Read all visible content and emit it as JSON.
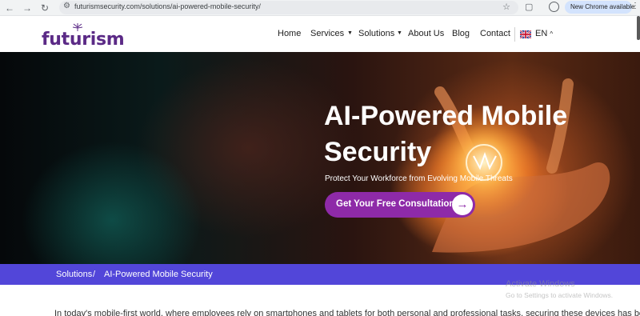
{
  "browser": {
    "url": "futurismsecurity.com/solutions/ai-powered-mobile-security/",
    "update_label": "New Chrome available",
    "back_icon": "arrow-left-icon",
    "forward_icon": "arrow-right-icon",
    "reload_icon": "reload-icon"
  },
  "site": {
    "logo_text": "futurism",
    "brand_color": "#5b2a86",
    "accent_color": "#8e2aa8",
    "nav": {
      "home": "Home",
      "services": "Services",
      "solutions": "Solutions",
      "about": "About Us",
      "blog": "Blog",
      "contact": "Contact",
      "language": "EN"
    }
  },
  "hero": {
    "title": "AI-Powered Mobile Security",
    "subtitle": "Protect Your Workforce from Evolving Mobile Threats",
    "cta_label": "Get Your Free Consultation"
  },
  "breadcrumb": {
    "bar_color": "#5246d9",
    "parent": "Solutions",
    "separator": "/",
    "current": "AI-Powered Mobile Security"
  },
  "content": {
    "intro": "In today's mobile-first world, where employees rely on smartphones and tablets for both personal and professional tasks, securing these devices has become"
  },
  "watermark": {
    "title": "Activate Windows",
    "subtitle": "Go to Settings to activate Windows."
  }
}
